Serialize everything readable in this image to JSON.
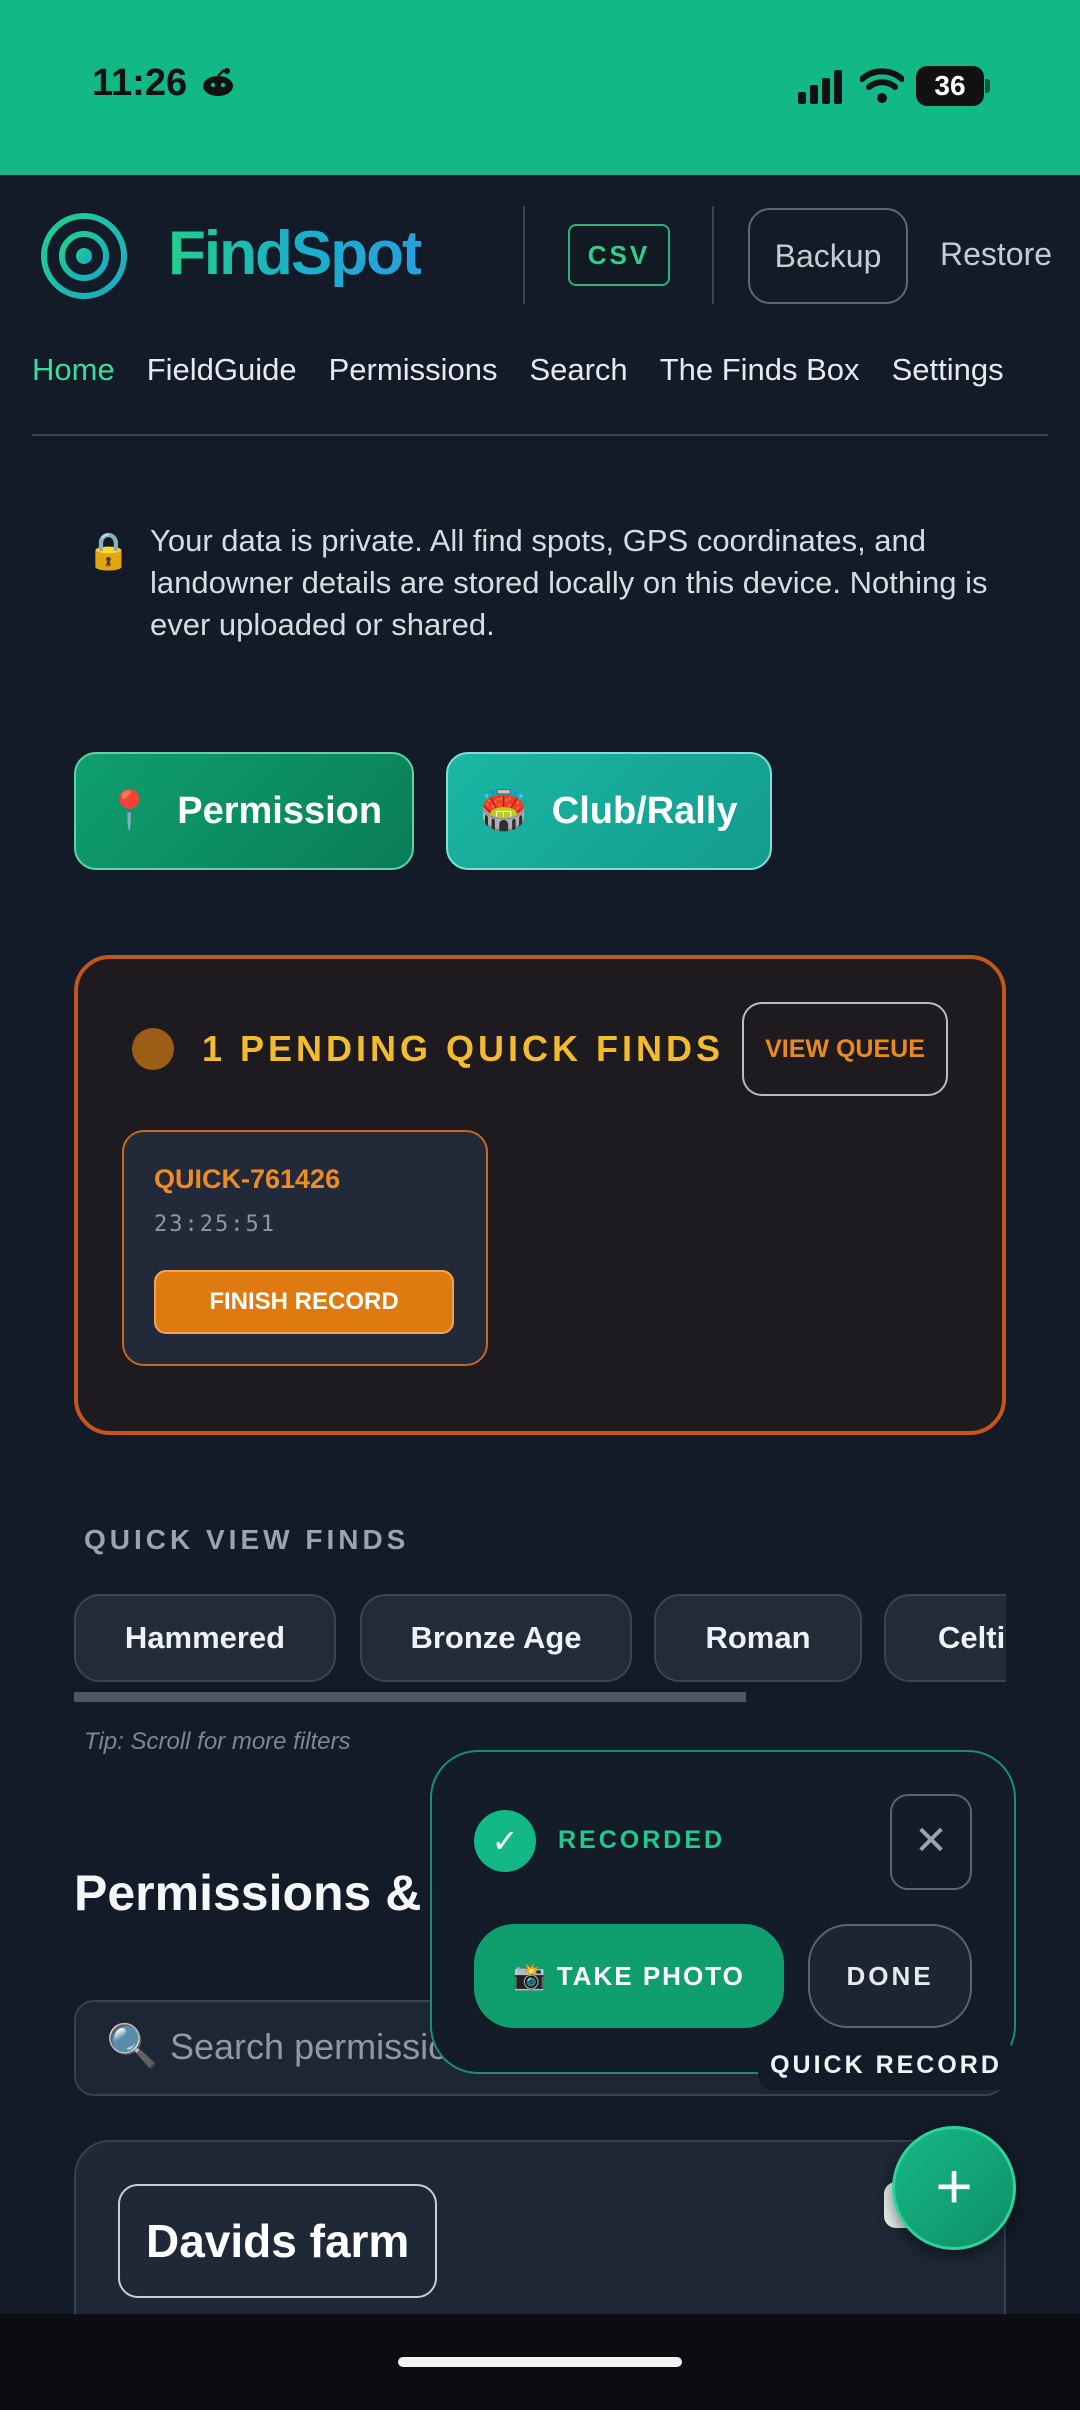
{
  "status_bar": {
    "time": "11:26",
    "battery": "36",
    "bg_color": "#12b886"
  },
  "header": {
    "app_name": "FindSpot",
    "csv_label": "CSV",
    "backup_label": "Backup",
    "restore_label": "Restore"
  },
  "nav": {
    "items": [
      {
        "label": "Home",
        "active": true
      },
      {
        "label": "FieldGuide"
      },
      {
        "label": "Permissions"
      },
      {
        "label": "Search"
      },
      {
        "label": "The Finds Box"
      },
      {
        "label": "Settings"
      }
    ]
  },
  "privacy": {
    "icon": "lock-icon",
    "text": "Your data is private. All find spots, GPS coordinates, and landowner details are stored locally on this device. Nothing is ever uploaded or shared."
  },
  "actions": {
    "permission_label": "Permission",
    "permission_icon": "📍",
    "club_label": "Club/Rally",
    "club_icon": "🏟️"
  },
  "pending": {
    "title": "1 PENDING QUICK FINDS",
    "view_queue_label": "VIEW QUEUE",
    "items": [
      {
        "id": "QUICK-761426",
        "time": "23:25:51",
        "button_label": "FINISH RECORD"
      }
    ]
  },
  "quick_view": {
    "title": "QUICK VIEW FINDS",
    "chips": [
      "Hammered",
      "Bronze Age",
      "Roman",
      "Celtic"
    ],
    "tip": "Tip: Scroll for more filters"
  },
  "permissions": {
    "heading": "Permissions & ",
    "search_placeholder": "Search permissio",
    "cards": [
      {
        "name": "Davids farm"
      }
    ]
  },
  "quick_record": {
    "status": "RECORDED",
    "check": "✓",
    "close": "✕",
    "take_photo_label": "📸 TAKE PHOTO",
    "done_label": "DONE",
    "label": "QUICK RECORD",
    "fab": "+"
  }
}
